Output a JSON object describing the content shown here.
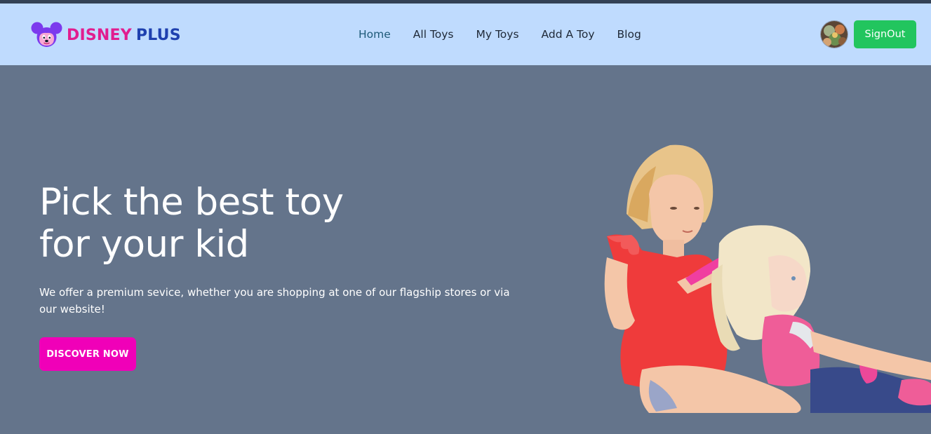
{
  "brand": {
    "word1": "DISNEY",
    "word2": "PLUS",
    "icon": "mouse-face-logo-icon",
    "colors": {
      "word1": "#e11d8f",
      "word2": "#1e40af",
      "icon": "#7c3aed"
    }
  },
  "nav": {
    "items": [
      {
        "label": "Home",
        "active": true
      },
      {
        "label": "All Toys",
        "active": false
      },
      {
        "label": "My Toys",
        "active": false
      },
      {
        "label": "Add A Toy",
        "active": false
      },
      {
        "label": "Blog",
        "active": false
      }
    ]
  },
  "user": {
    "signout_label": "SignOut"
  },
  "hero": {
    "title_line1": "Pick the best toy",
    "title_line2": "for your kid",
    "description": "We offer a premium sevice, whether you are shopping at one of our flagship stores or via our website!",
    "cta_label": "DISCOVER NOW"
  },
  "colors": {
    "navbar_bg": "#bfdbfe",
    "hero_bg": "#64748b",
    "cta_bg": "#f000b8",
    "signout_bg": "#22c55e",
    "active_nav": "#1e5a78"
  }
}
